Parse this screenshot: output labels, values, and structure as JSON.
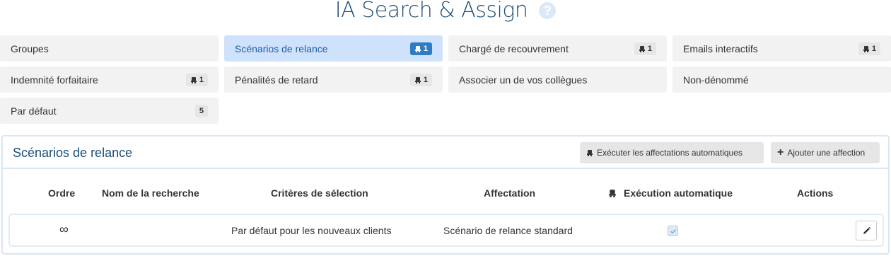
{
  "header": {
    "title": "IA Search & Assign",
    "help_icon": "question-circle-icon"
  },
  "groups": [
    {
      "label": "Groupes",
      "badge": null,
      "robot": false,
      "active": false
    },
    {
      "label": "Scénarios de relance",
      "badge": "1",
      "robot": true,
      "active": true
    },
    {
      "label": "Chargé de recouvrement",
      "badge": "1",
      "robot": true,
      "active": false
    },
    {
      "label": "Emails interactifs",
      "badge": "1",
      "robot": true,
      "active": false
    },
    {
      "label": "Indemnité forfaitaire",
      "badge": "1",
      "robot": true,
      "active": false
    },
    {
      "label": "Pénalités de retard",
      "badge": "1",
      "robot": true,
      "active": false
    },
    {
      "label": "Associer un de vos collègues",
      "badge": null,
      "robot": false,
      "active": false
    },
    {
      "label": "Non-dénommé",
      "badge": null,
      "robot": false,
      "active": false
    },
    {
      "label": "Par défaut",
      "badge": "5",
      "robot": false,
      "active": false
    }
  ],
  "panel": {
    "title": "Scénarios de relance",
    "execute_button": "Exécuter les affectations automatiques",
    "add_button": "Ajouter une affection"
  },
  "table": {
    "columns": [
      "Ordre",
      "Nom de la recherche",
      "Critères de sélection",
      "Affectation",
      "Exécution automatique",
      "Actions"
    ],
    "rows": [
      {
        "order": "∞",
        "name": "",
        "criteria": "Par défaut pour les nouveaux clients",
        "assignment": "Scénario de relance standard",
        "auto_execution": true
      }
    ]
  },
  "colors": {
    "title": "#1f4e79",
    "active_bg": "#cfe2fb",
    "active_text": "#1d5fa8",
    "active_badge": "#2f7bc4",
    "panel_border": "#d8e6f6"
  }
}
